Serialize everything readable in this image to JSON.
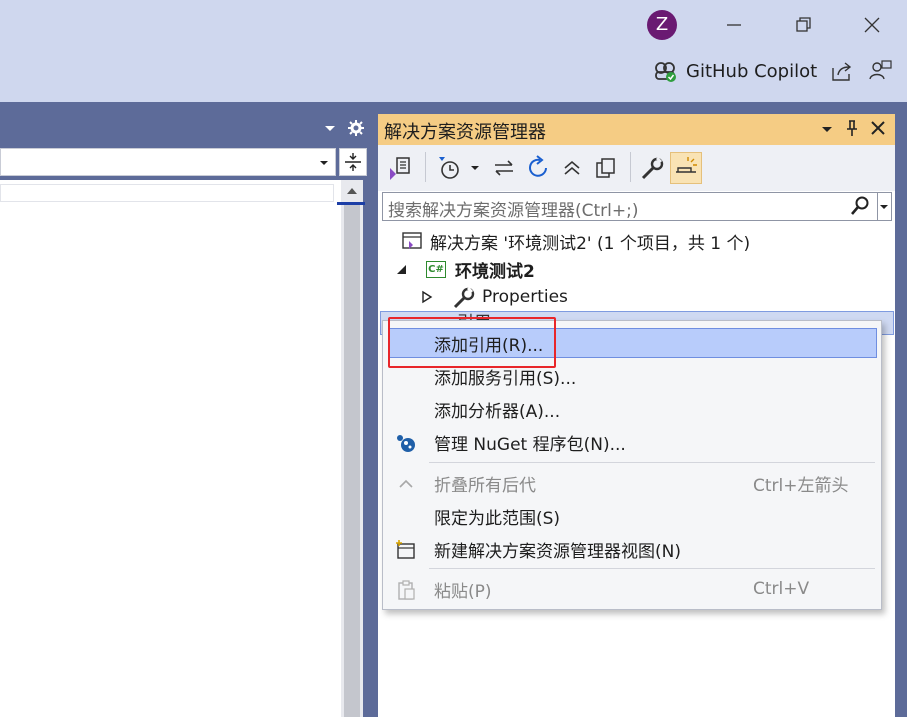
{
  "window": {
    "avatar_letter": "Z",
    "copilot_label": "GitHub Copilot"
  },
  "solution_explorer": {
    "title": "解决方案资源管理器",
    "search_placeholder": "搜索解决方案资源管理器(Ctrl+;)",
    "tree": {
      "solution": "解决方案 '环境测试2' (1 个项目，共 1 个)",
      "project": "环境测试2",
      "project_badge": "C#",
      "properties": "Properties",
      "references": "引用"
    }
  },
  "context_menu": {
    "items": [
      {
        "label": "添加引用(R)...",
        "shortcut": "",
        "enabled": true,
        "highlighted": true
      },
      {
        "label": "添加服务引用(S)...",
        "shortcut": "",
        "enabled": true
      },
      {
        "label": "添加分析器(A)...",
        "shortcut": "",
        "enabled": true
      },
      {
        "label": "管理 NuGet 程序包(N)...",
        "shortcut": "",
        "enabled": true,
        "icon": "nuget-icon"
      },
      {
        "label": "折叠所有后代",
        "shortcut": "Ctrl+左箭头",
        "enabled": false,
        "icon": "chevron-up-icon"
      },
      {
        "label": "限定为此范围(S)",
        "shortcut": "",
        "enabled": true
      },
      {
        "label": "新建解决方案资源管理器视图(N)",
        "shortcut": "",
        "enabled": true,
        "icon": "new-view-icon"
      },
      {
        "label": "粘贴(P)",
        "shortcut": "Ctrl+V",
        "enabled": false,
        "icon": "paste-icon"
      }
    ]
  },
  "colors": {
    "titlebar": "#cfd7ee",
    "frame": "#5d6b99",
    "se_title": "#f5cc84",
    "menu_highlight": "#b8ccfb",
    "annotation_red": "#e8262a"
  }
}
